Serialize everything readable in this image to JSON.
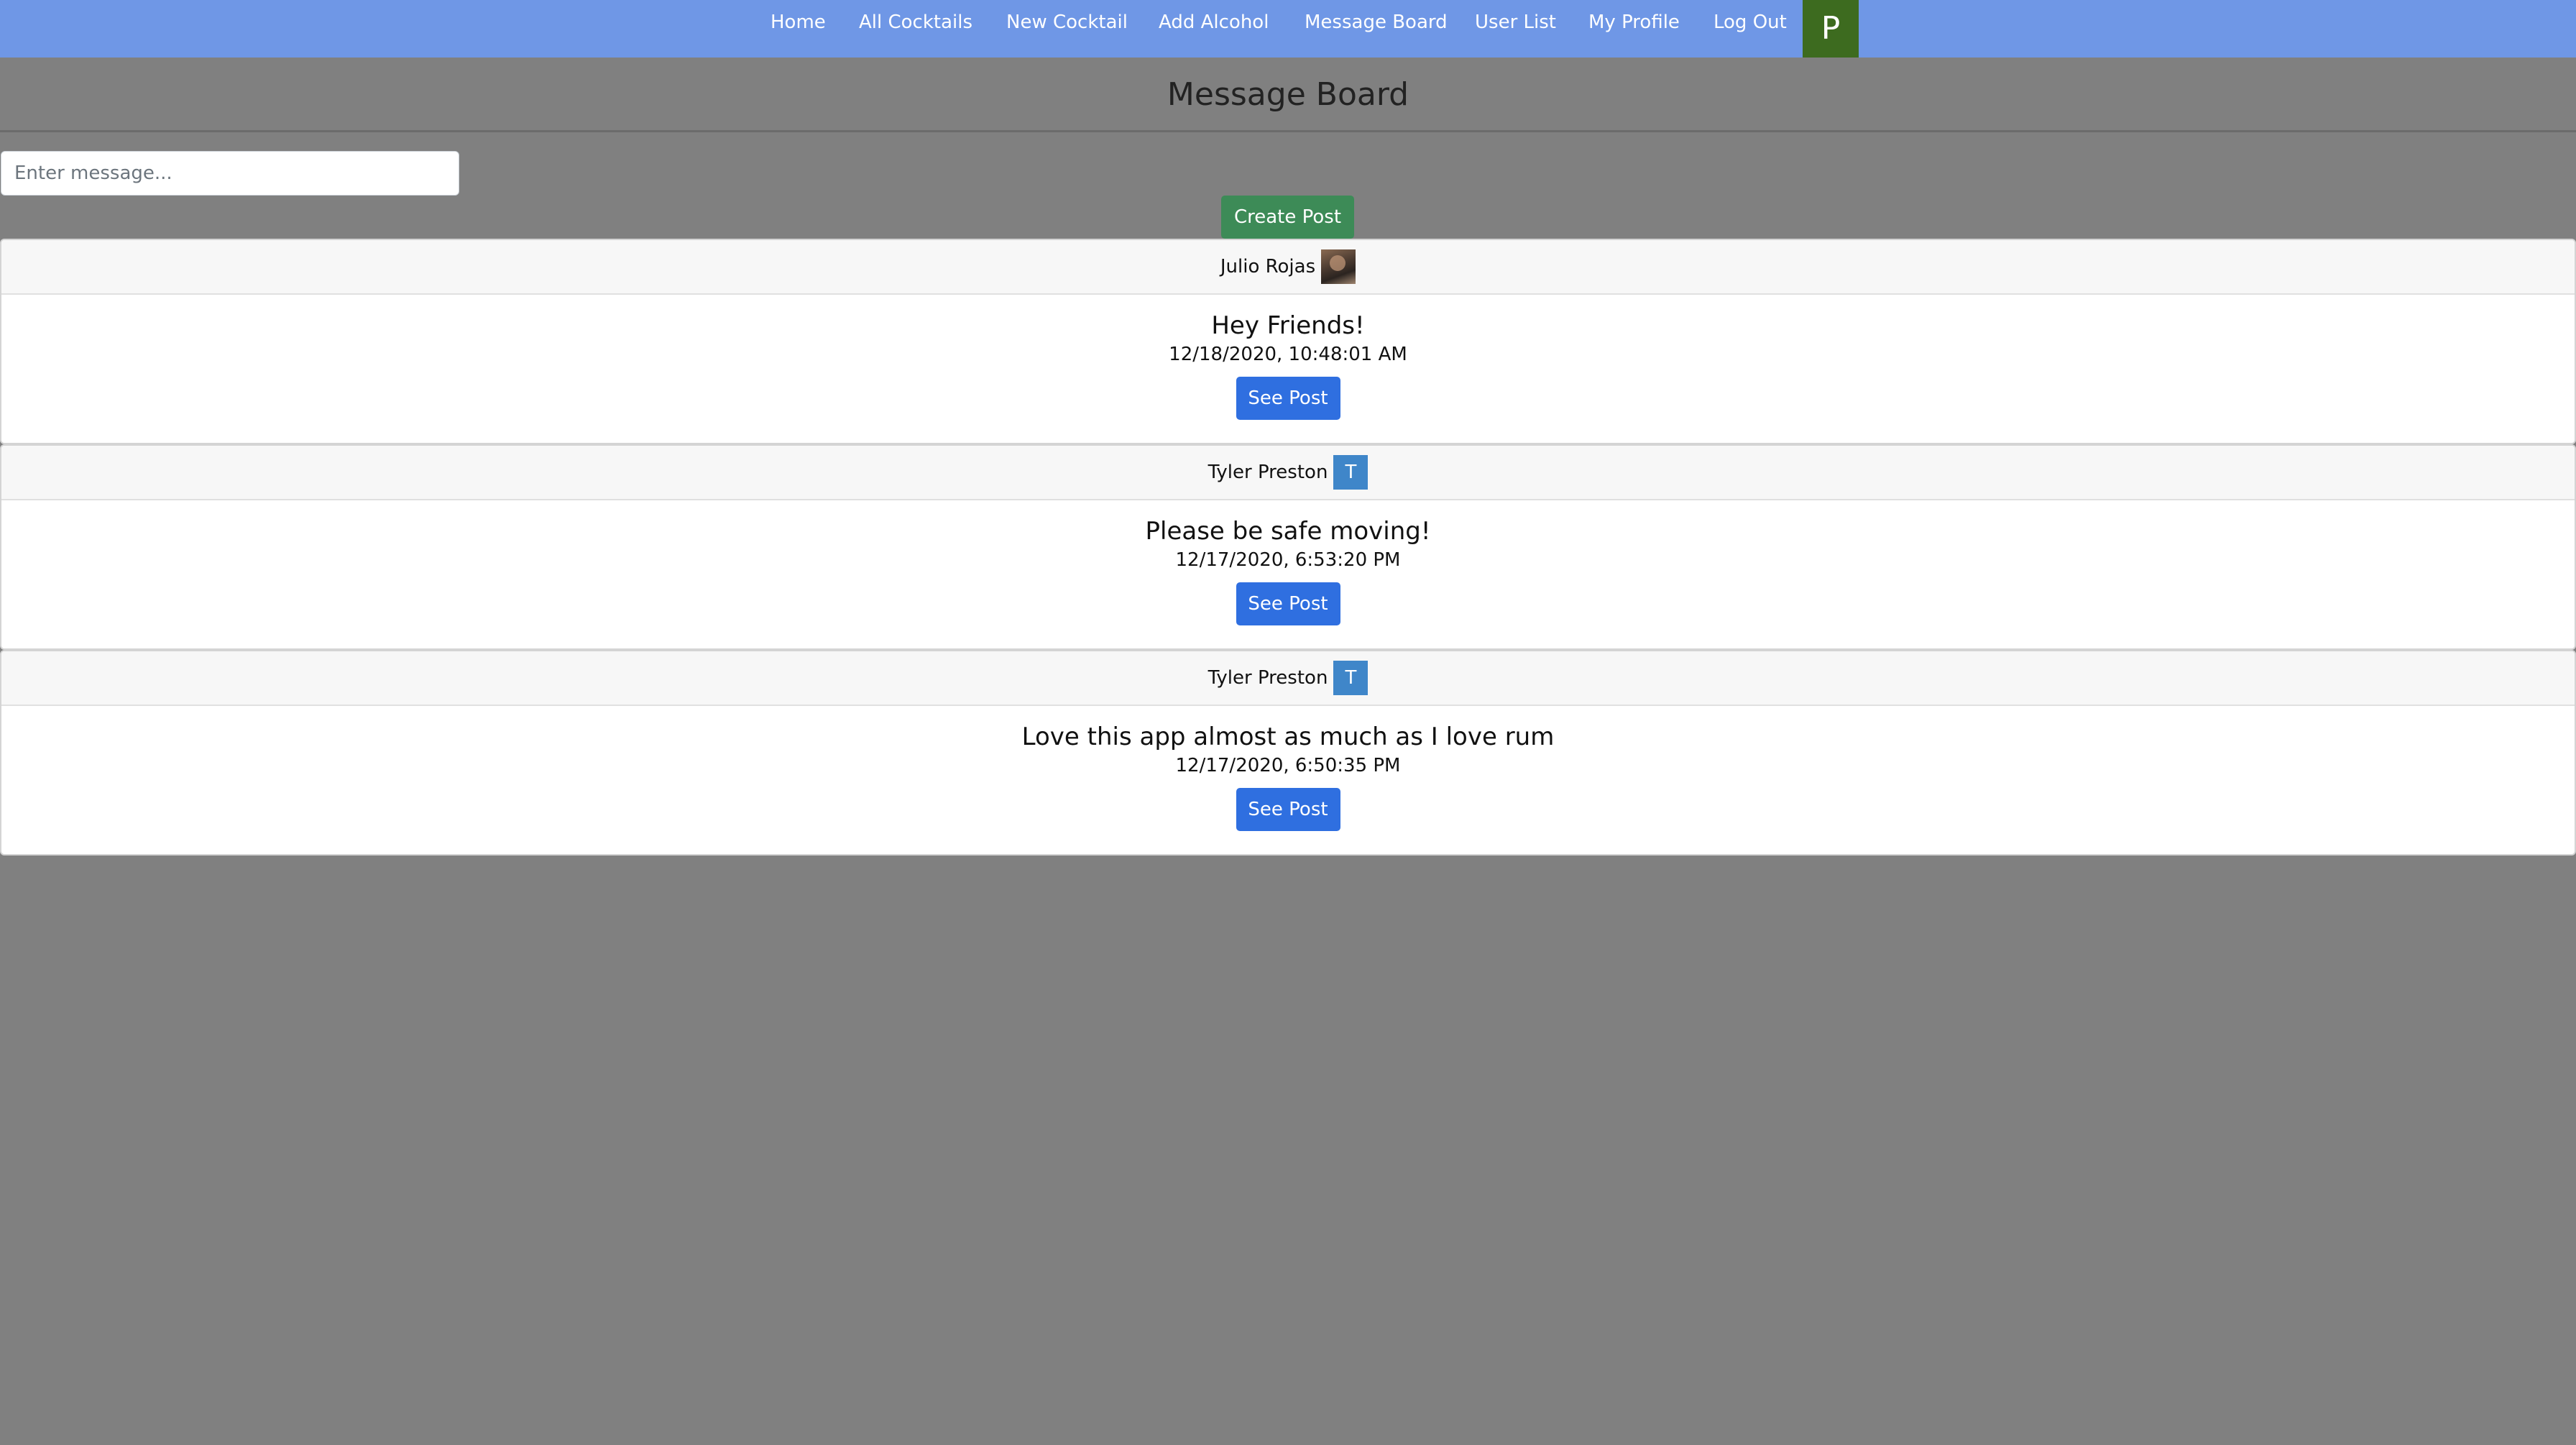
{
  "nav": {
    "items": [
      "Home",
      "All Cocktails",
      "New Cocktail",
      "Add Alcohol",
      "Message Board",
      "User List",
      "My Profile",
      "Log Out"
    ],
    "avatar_initial": "P",
    "bar_color": "#6f97e6",
    "avatar_color": "#3d6b1f"
  },
  "page": {
    "title": "Message Board"
  },
  "composer": {
    "placeholder": "Enter message...",
    "value": "",
    "button_label": "Create Post",
    "button_color": "#3d8b57"
  },
  "posts": [
    {
      "author": "Julio Rojas",
      "avatar_type": "photo",
      "avatar_initial": "",
      "message": "Hey Friends!",
      "timestamp": "12/18/2020, 10:48:01 AM",
      "button_label": "See Post"
    },
    {
      "author": "Tyler Preston",
      "avatar_type": "initial",
      "avatar_initial": "T",
      "message": "Please be safe moving!",
      "timestamp": "12/17/2020, 6:53:20 PM",
      "button_label": "See Post"
    },
    {
      "author": "Tyler Preston",
      "avatar_type": "initial",
      "avatar_initial": "T",
      "message": "Love this app almost as much as I love rum",
      "timestamp": "12/17/2020, 6:50:35 PM",
      "button_label": "See Post"
    }
  ],
  "colors": {
    "background": "#808080",
    "primary_button": "#2f6fe0",
    "initial_avatar": "#3f86c9"
  }
}
